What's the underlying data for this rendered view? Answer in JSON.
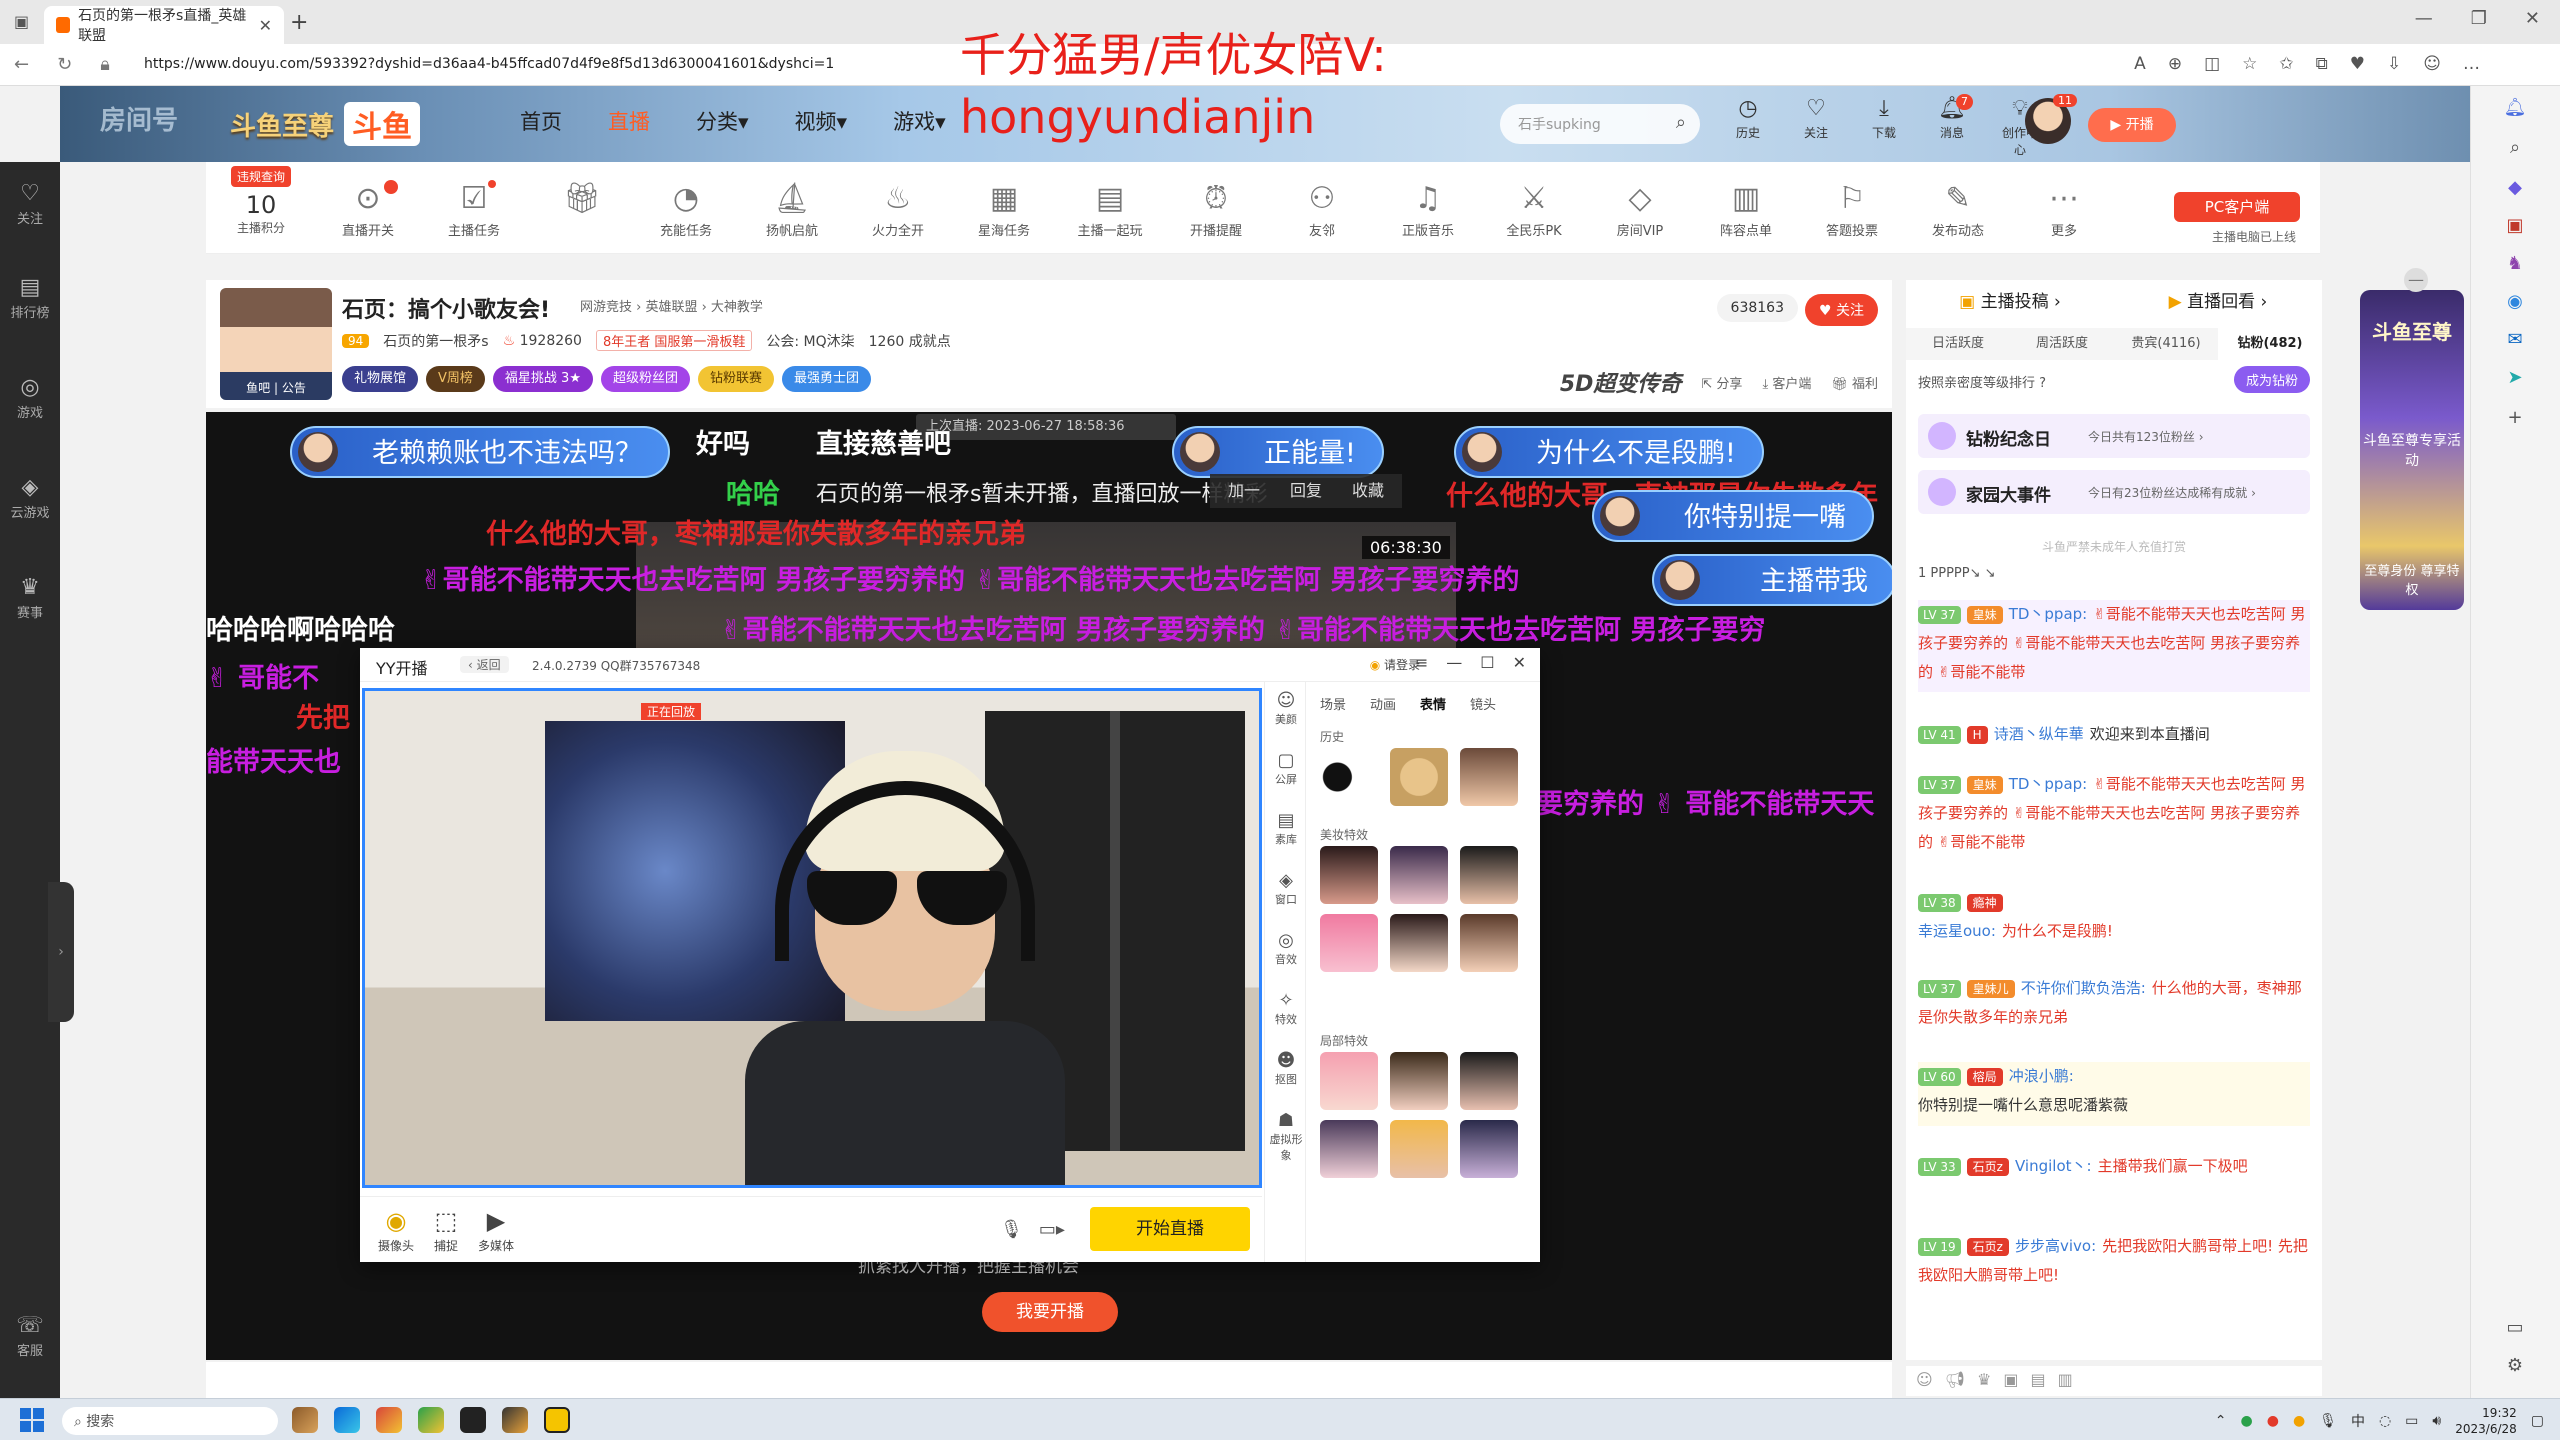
{
  "browser": {
    "tab_title": "石页的第一根矛s直播_英雄联盟",
    "tab_close": "✕",
    "new_tab": "+",
    "url": "https://www.douyu.com/593392?dyshid=d36aa4-b45ffcad07d4f9e8f5d13d6300041601&dyshci=1",
    "win_min": "—",
    "win_max": "❐",
    "win_close": "✕"
  },
  "overlay": {
    "line1": "千分猛男/声优女陪V:",
    "line2": "hongyundianjin"
  },
  "site": {
    "crest": "斗鱼至尊",
    "brand": "斗鱼",
    "nav": [
      "首页",
      "直播",
      "分类▾",
      "视频▾",
      "游戏▾"
    ],
    "search_placeholder": "石手supking",
    "tools": [
      {
        "label": "历史",
        "icon": "clock-icon",
        "badge": ""
      },
      {
        "label": "关注",
        "icon": "heart-icon",
        "badge": ""
      },
      {
        "label": "下载",
        "icon": "download-icon",
        "badge": ""
      },
      {
        "label": "消息",
        "icon": "bell-icon",
        "badge": "7"
      },
      {
        "label": "创作中心",
        "icon": "lightbulb-icon",
        "badge": ""
      }
    ],
    "avatar_badge": "11",
    "kaibo": "开播"
  },
  "leftbar": {
    "items": [
      {
        "label": "关注",
        "icon": "♡"
      },
      {
        "label": "排行榜",
        "icon": "▤"
      },
      {
        "label": "游戏",
        "icon": "◎"
      },
      {
        "label": "云游戏",
        "icon": "◈"
      },
      {
        "label": "赛事",
        "icon": "♛"
      },
      {
        "label": "客服",
        "icon": "☏"
      }
    ],
    "expand": "›"
  },
  "toolbar": {
    "score_tag": "违规查询",
    "score_num": "10",
    "score_label": "主播积分",
    "items": [
      "直播开关",
      "主播任务",
      "",
      "充能任务",
      "扬帆启航",
      "火力全开",
      "星海任务",
      "主播一起玩",
      "开播提醒",
      "友邻",
      "正版音乐",
      "全民乐PK",
      "房间VIP",
      "阵容点单",
      "答题投票",
      "发布动态",
      "更多"
    ],
    "pc_client": "PC客户端",
    "pc_note": "主播电脑已上线"
  },
  "room": {
    "avatar_label": "鱼吧 | 公告",
    "title": "石页：搞个小歌友会!",
    "cats": "网游竞技 › 英雄联盟 › 大神教学",
    "level": "94",
    "streamer": "石页的第一根矛s",
    "hot": "1928260",
    "honor": "8年王者 国服第一滑板鞋",
    "guild": "公会: MQ沐柒",
    "followers": "1260 成就点",
    "badges": [
      "礼物展馆",
      "V周榜",
      "福星挑战 3★",
      "超级粉丝团",
      "钻粉联赛",
      "最强勇士团"
    ],
    "viewer_count": "638163",
    "follow": "♥ 关注",
    "brand5d": "5D超变传奇",
    "actions": [
      "分享",
      "客户端",
      "福利"
    ]
  },
  "video": {
    "replay_bar": "上次直播: 2023-06-27 18:58:36",
    "ctx": [
      "加一",
      "回复",
      "收藏"
    ],
    "time_chip": "06:38:30",
    "caption": "抓紧找人开播，把握主播机会",
    "start_btn": "我要开播",
    "danmaku": [
      "老赖赖账也不违法吗？",
      "正能量!",
      "为什么不是段鹏!",
      "你特别提一嘴",
      "主播带我",
      "哈哈",
      "什么他的大哥，枣神那是你失散多年的亲兄弟",
      "✌哥能不能带天天也去吃苦阿 男孩子要穷养的 ✌哥能不能带天天也去吃苦阿 男孩子要穷养的",
      "✌哥能不能带天天也去吃苦阿 男孩子要穷养的 ✌哥能不能带天天也去吃苦阿 男孩子要穷",
      "哈哈哈啊哈哈哈",
      "✌ 哥能不",
      "先把",
      "能带天天也",
      "要穷养的 ✌ 哥能不能带天天",
      "石页的第一根矛s暂未开播，直播回放一样精彩",
      "直接慈善吧",
      "什么他的大哥，枣神那是你失散多年",
      "好吗"
    ]
  },
  "yy": {
    "name": "YY开播",
    "back": "‹ 返回",
    "version": "2.4.0.2739 QQ群735767348",
    "login": "请登录",
    "controls": [
      "≡",
      "—",
      "☐",
      "✕"
    ],
    "rec_tag": "正在回放",
    "bottom": [
      "摄像头",
      "捕捉",
      "多媒体"
    ],
    "start": "开始直播",
    "side": [
      "美颜",
      "公屏",
      "素库",
      "窗口",
      "音效",
      "特效",
      "抠图",
      "虚拟形象"
    ],
    "tabs": [
      "场景",
      "动画",
      "表情",
      "镜头"
    ],
    "active_tab": "表情",
    "sections": [
      "历史",
      "美妆特效",
      "局部特效"
    ]
  },
  "chat": {
    "top": [
      "主播投稿 ›",
      "直播回看 ›"
    ],
    "rank_tabs": [
      "日活跃度",
      "周活跃度",
      "贵宾(4116)",
      "钻粉(482)"
    ],
    "sort_line": "按照亲密度等级排行 ?",
    "become_fan": "成为钻粉",
    "cards": [
      {
        "title": "钻粉纪念日",
        "desc": "今日共有123位粉丝 ›"
      },
      {
        "title": "家园大事件",
        "desc": "今日有23位粉丝达成稀有成就 ›"
      }
    ],
    "notice": "斗鱼严禁未成年人充值打赏",
    "topfans": "1  PPPPP↘ ↘",
    "messages": [
      {
        "lv": "LV 37",
        "medal": "皇妹",
        "user": "TD丶ppap:",
        "text": "✌哥能不能带天天也去吃苦阿 男孩子要穷养的 ✌哥能不能带天天也去吃苦阿 男孩子要穷养的 ✌哥能不能带",
        "style": "red",
        "hl": "hl"
      },
      {
        "lv": "LV 41",
        "medal": "H",
        "user": "诗酒丶纵年華",
        "text": "欢迎来到本直播间",
        "style": "plain",
        "hl": ""
      },
      {
        "lv": "LV 37",
        "medal": "皇妹",
        "user": "TD丶ppap:",
        "text": "✌哥能不能带天天也去吃苦阿 男孩子要穷养的 ✌哥能不能带天天也去吃苦阿 男孩子要穷养的 ✌哥能不能带",
        "style": "red",
        "hl": ""
      },
      {
        "lv": "LV 38",
        "medal": "瘾神",
        "user": "幸运星ouo:",
        "text": "为什么不是段鹏!",
        "style": "red",
        "hl": ""
      },
      {
        "lv": "LV 37",
        "medal": "皇妹儿",
        "user": "不许你们欺负浩浩:",
        "text": "什么他的大哥，枣神那是你失散多年的亲兄弟",
        "style": "red",
        "hl": ""
      },
      {
        "lv": "LV 60",
        "medal": "榕局",
        "user": "冲浪小鹏:",
        "text": "你特别提一嘴什么意思呢潘紫薇",
        "style": "plain",
        "hl": "hy"
      },
      {
        "lv": "LV 33",
        "medal": "石页z",
        "user": "Vingilot丶:",
        "text": "主播带我们赢一下极吧",
        "style": "red",
        "hl": ""
      },
      {
        "lv": "LV 19",
        "medal": "石页z",
        "user": "步步高vivo:",
        "text": "先把我欧阳大鹏哥带上吧! 先把我欧阳大鹏哥带上吧!",
        "style": "red",
        "hl": ""
      }
    ]
  },
  "promo": {
    "title": "斗鱼至尊",
    "sub": "斗鱼至尊专享活动",
    "bottom": "至尊身份 尊享特权",
    "close": "—"
  },
  "taskbar": {
    "search": "搜索",
    "lang": "中",
    "time": "19:32",
    "date": "2023/6/28"
  }
}
